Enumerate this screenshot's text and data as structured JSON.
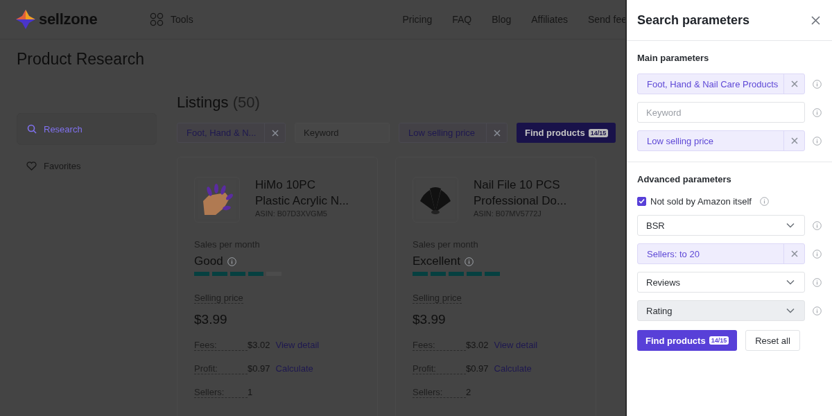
{
  "header": {
    "logo": "sellzone",
    "tools": "Tools",
    "nav": [
      "Pricing",
      "FAQ",
      "Blog",
      "Affiliates",
      "Send fee"
    ]
  },
  "page_title": "Product Research",
  "sidebar": {
    "items": [
      {
        "label": "Research",
        "selected": true
      },
      {
        "label": "Favorites",
        "selected": false
      }
    ]
  },
  "listings": {
    "title": "Listings",
    "count": "(50)",
    "filters": [
      {
        "kind": "chip",
        "value": "Foot, Hand & N..."
      },
      {
        "kind": "input",
        "placeholder": "Keyword"
      },
      {
        "kind": "chip",
        "value": "Low selling price"
      }
    ],
    "find_button": {
      "label": "Find products",
      "badge": "14/15"
    },
    "cards": [
      {
        "title_lines": [
          "HiMo 10PC",
          "Plastic Acrylic N..."
        ],
        "asin": "ASIN: B07D3XVGM5",
        "sales_label": "Sales per month",
        "sales_rating": "Good",
        "level": 0.8,
        "price_label": "Selling price",
        "price": "$3.99",
        "rows": [
          {
            "label": "Fees:",
            "value": "$3.02",
            "link": "View detail"
          },
          {
            "label": "Profit:",
            "value": "$0.97",
            "link": "Calculate"
          },
          {
            "label": "Sellers:",
            "value": "1"
          }
        ]
      },
      {
        "title_lines": [
          "Nail File 10 PCS",
          "Professional Do..."
        ],
        "asin": "ASIN: B07MV5772J",
        "sales_label": "Sales per month",
        "sales_rating": "Excellent",
        "level": 1,
        "price_label": "Selling price",
        "price": "$3.99",
        "rows": [
          {
            "label": "Fees:",
            "value": "$3.02",
            "link": "View detail"
          },
          {
            "label": "Profit:",
            "value": "$0.97",
            "link": "Calculate"
          },
          {
            "label": "Sellers:",
            "value": "2"
          }
        ]
      }
    ]
  },
  "panel": {
    "title": "Search parameters",
    "sections": [
      {
        "title": "Main parameters",
        "fields": [
          {
            "kind": "chip",
            "value": "Foot, Hand & Nail Care Products"
          },
          {
            "kind": "input",
            "placeholder": "Keyword"
          },
          {
            "kind": "chip",
            "value": "Low selling price"
          }
        ]
      },
      {
        "title": "Advanced parameters",
        "fields": [
          {
            "kind": "checkbox",
            "label": "Not sold by Amazon itself",
            "checked": true
          },
          {
            "kind": "select",
            "value": "BSR",
            "disabled": false
          },
          {
            "kind": "chip",
            "value": "Sellers: to 20"
          },
          {
            "kind": "select",
            "value": "Reviews",
            "disabled": false
          },
          {
            "kind": "select",
            "value": "Rating",
            "disabled": true
          }
        ]
      }
    ],
    "find_button": {
      "label": "Find products",
      "badge": "14/15"
    },
    "reset_button": "Reset all"
  }
}
